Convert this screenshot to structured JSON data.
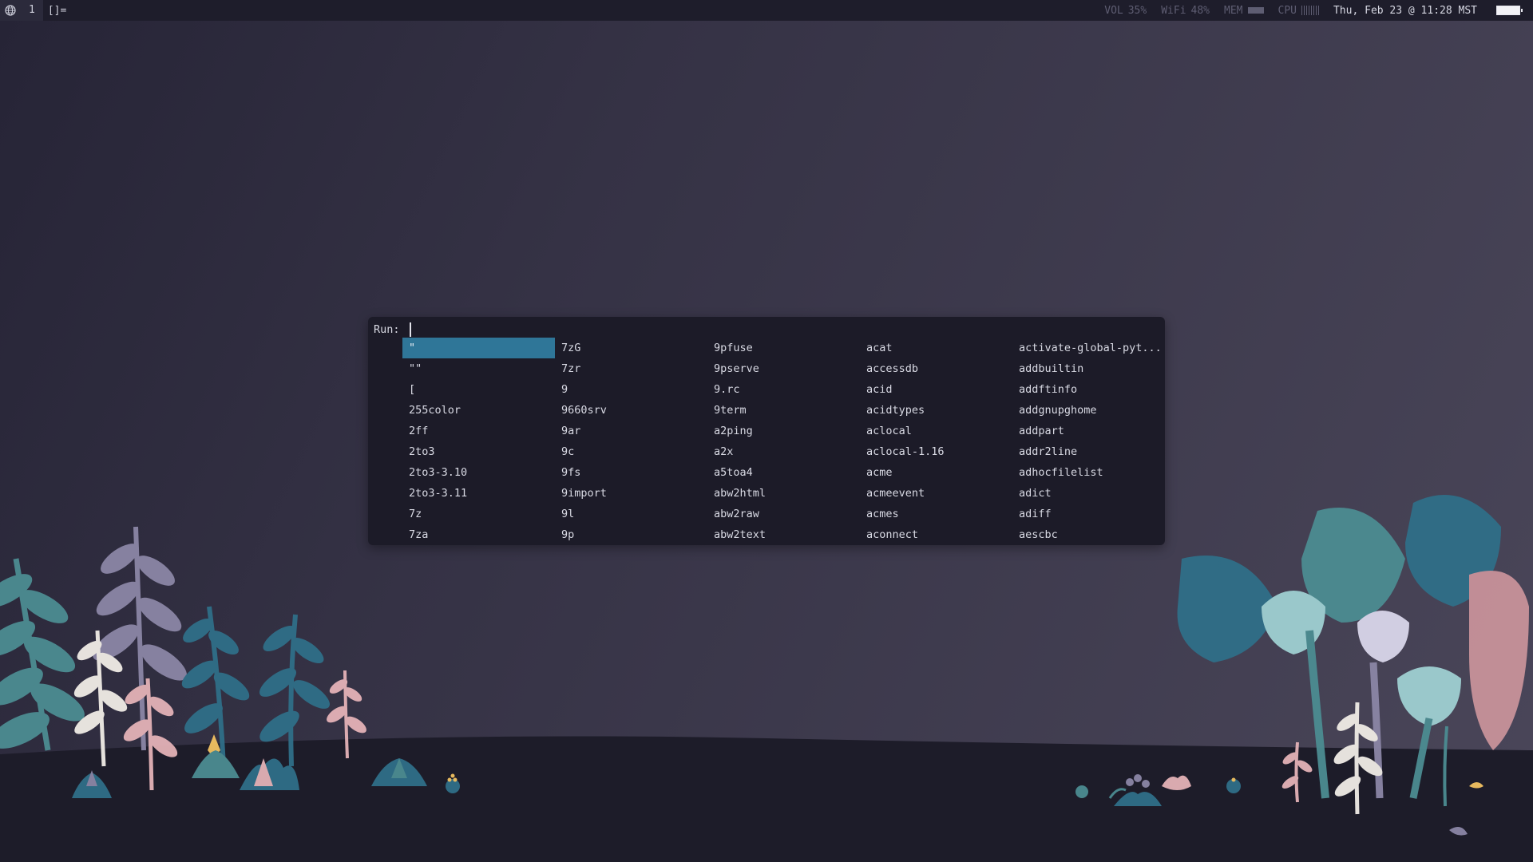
{
  "topbar": {
    "tag": "1",
    "layout": "[]=",
    "vol_label": "VOL",
    "vol_value": "35%",
    "wifi_label": "WiFi",
    "wifi_value": "48%",
    "mem_label": "MEM",
    "cpu_label": "CPU",
    "clock": "Thu, Feb 23 @ 11:28 MST"
  },
  "dmenu": {
    "prompt": "Run:",
    "columns": [
      [
        "\"",
        "\"\"",
        "[",
        "255color",
        "2ff",
        "2to3",
        "2to3-3.10",
        "2to3-3.11",
        "7z",
        "7za"
      ],
      [
        "7zG",
        "7zr",
        "9",
        "9660srv",
        "9ar",
        "9c",
        "9fs",
        "9import",
        "9l",
        "9p"
      ],
      [
        "9pfuse",
        "9pserve",
        "9.rc",
        "9term",
        "a2ping",
        "a2x",
        "a5toa4",
        "abw2html",
        "abw2raw",
        "abw2text"
      ],
      [
        "acat",
        "accessdb",
        "acid",
        "acidtypes",
        "aclocal",
        "aclocal-1.16",
        "acme",
        "acmeevent",
        "acmes",
        "aconnect"
      ],
      [
        "activate-global-pyt...",
        "addbuiltin",
        "addftinfo",
        "addgnupghome",
        "addpart",
        "addr2line",
        "adhocfilelist",
        "adict",
        "adiff",
        "aescbc"
      ]
    ],
    "selected": "\""
  },
  "colors": {
    "bar_bg": "#1e1d2b",
    "menu_bg": "#1c1b28",
    "selection": "#2f7698",
    "ground": "#1d1c29"
  }
}
